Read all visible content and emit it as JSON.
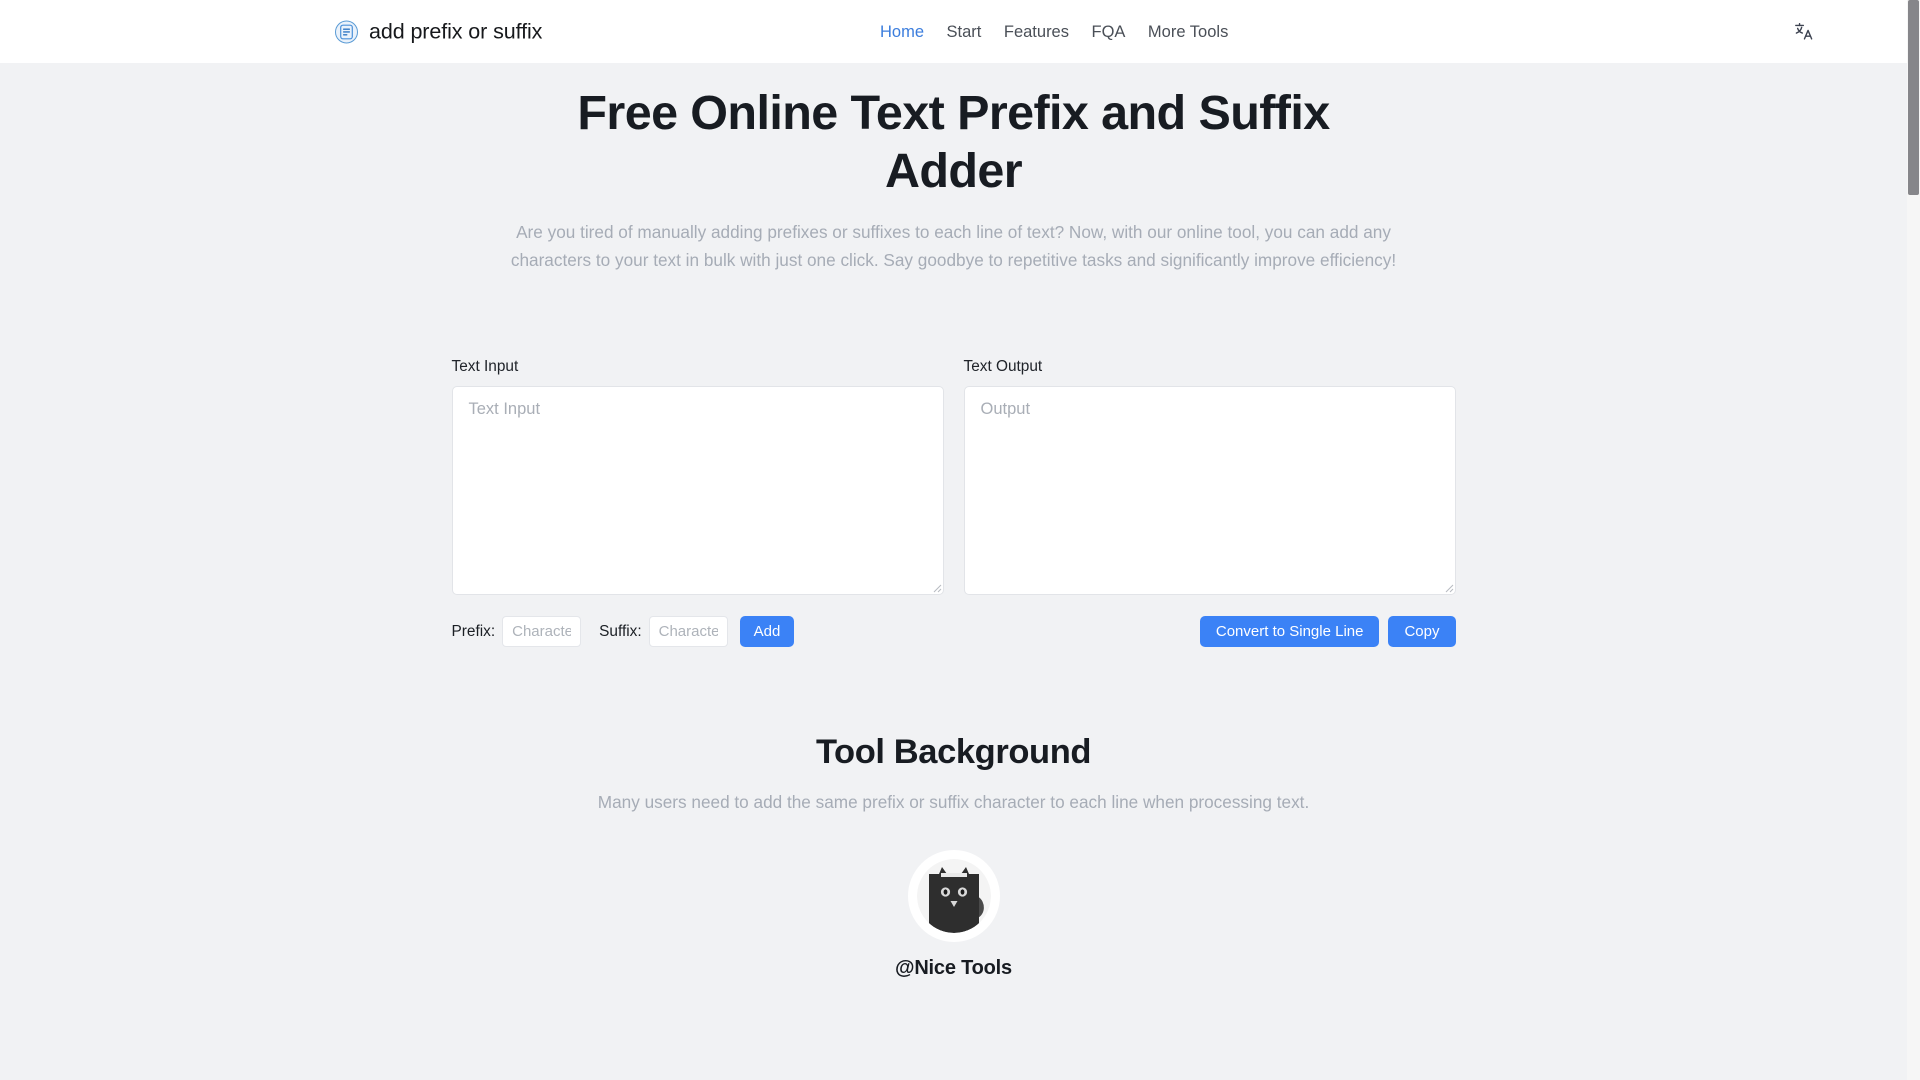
{
  "header": {
    "logo_icon": "document-lines-icon",
    "brand_title": "add prefix or suffix",
    "nav": [
      {
        "label": "Home",
        "active": true
      },
      {
        "label": "Start",
        "active": false
      },
      {
        "label": "Features",
        "active": false
      },
      {
        "label": "FQA",
        "active": false
      },
      {
        "label": "More Tools",
        "active": false
      }
    ],
    "language_icon": "translate-language-icon"
  },
  "hero": {
    "title": "Free Online Text Prefix and Suffix Adder",
    "description": "Are you tired of manually adding prefixes or suffixes to each line of text? Now, with our online tool, you can add any characters to your text in bulk with just one click. Say goodbye to repetitive tasks and significantly improve efficiency!"
  },
  "tool": {
    "input_pane": {
      "label": "Text Input",
      "placeholder": "Text Input",
      "value": ""
    },
    "output_pane": {
      "label": "Text Output",
      "placeholder": "Output",
      "value": ""
    },
    "controls": {
      "prefix_label": "Prefix:",
      "prefix_placeholder": "Character",
      "prefix_value": "",
      "suffix_label": "Suffix:",
      "suffix_placeholder": "Character",
      "suffix_value": "",
      "add_label": "Add",
      "convert_label": "Convert to Single Line",
      "copy_label": "Copy"
    }
  },
  "background_section": {
    "title": "Tool Background",
    "description": "Many users need to add the same prefix or suffix character to each line when processing text.",
    "avatar_icon": "black-cat-avatar",
    "avatar_name": "@Nice Tools"
  },
  "colors": {
    "accent_blue": "#3b82f6",
    "nav_active": "#3b7ddd",
    "page_bg": "#f1f2f4",
    "header_bg": "#ffffff",
    "muted_text": "#a6acb6"
  }
}
